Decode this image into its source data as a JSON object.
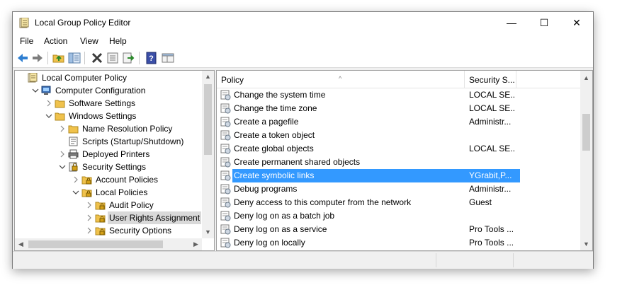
{
  "window": {
    "title": "Local Group Policy Editor",
    "controls": {
      "minimize": "—",
      "maximize": "☐",
      "close": "✕"
    }
  },
  "menu": [
    "File",
    "Action",
    "View",
    "Help"
  ],
  "toolbar": {
    "icons": [
      "back-icon",
      "forward-icon",
      "up-folder-icon",
      "show-hide-tree-icon",
      "delete-icon",
      "properties-icon",
      "export-list-icon",
      "help-icon",
      "view-icon"
    ]
  },
  "tree": {
    "items": [
      {
        "label": "Local Computer Policy",
        "icon": "policy-document-icon",
        "expander": ""
      },
      {
        "label": "Computer Configuration",
        "icon": "computer-icon",
        "expander": "expanded"
      },
      {
        "label": "Software Settings",
        "icon": "folder-icon",
        "expander": "collapsed"
      },
      {
        "label": "Windows Settings",
        "icon": "folder-icon",
        "expander": "expanded"
      },
      {
        "label": "Name Resolution Policy",
        "icon": "folder-icon",
        "expander": "collapsed"
      },
      {
        "label": "Scripts (Startup/Shutdown)",
        "icon": "script-icon",
        "expander": ""
      },
      {
        "label": "Deployed Printers",
        "icon": "printer-icon",
        "expander": "collapsed"
      },
      {
        "label": "Security Settings",
        "icon": "security-settings-icon",
        "expander": "expanded"
      },
      {
        "label": "Account Policies",
        "icon": "locked-folder-icon",
        "expander": "collapsed"
      },
      {
        "label": "Local Policies",
        "icon": "locked-folder-icon",
        "expander": "expanded"
      },
      {
        "label": "Audit Policy",
        "icon": "locked-folder-icon",
        "expander": "collapsed"
      },
      {
        "label": "User Rights Assignment",
        "icon": "locked-folder-icon",
        "expander": "collapsed",
        "selected": true
      },
      {
        "label": "Security Options",
        "icon": "locked-folder-icon",
        "expander": "collapsed"
      }
    ]
  },
  "list": {
    "columns": [
      "Policy",
      "Security S..."
    ],
    "rows": [
      {
        "policy": "Change the system time",
        "security": "LOCAL SE..."
      },
      {
        "policy": "Change the time zone",
        "security": "LOCAL SE..."
      },
      {
        "policy": "Create a pagefile",
        "security": "Administr..."
      },
      {
        "policy": "Create a token object",
        "security": ""
      },
      {
        "policy": "Create global objects",
        "security": "LOCAL SE..."
      },
      {
        "policy": "Create permanent shared objects",
        "security": ""
      },
      {
        "policy": "Create symbolic links",
        "security": "YGrabit,P...",
        "selected": true
      },
      {
        "policy": "Debug programs",
        "security": "Administr..."
      },
      {
        "policy": "Deny access to this computer from the network",
        "security": "Guest"
      },
      {
        "policy": "Deny log on as a batch job",
        "security": ""
      },
      {
        "policy": "Deny log on as a service",
        "security": "Pro Tools ..."
      },
      {
        "policy": "Deny log on locally",
        "security": "Pro Tools ..."
      }
    ]
  },
  "colors": {
    "selection": "#3399ff",
    "tree_selection": "#d9d9d9",
    "folder": "#f0c24c",
    "lock": "#d4a017"
  }
}
